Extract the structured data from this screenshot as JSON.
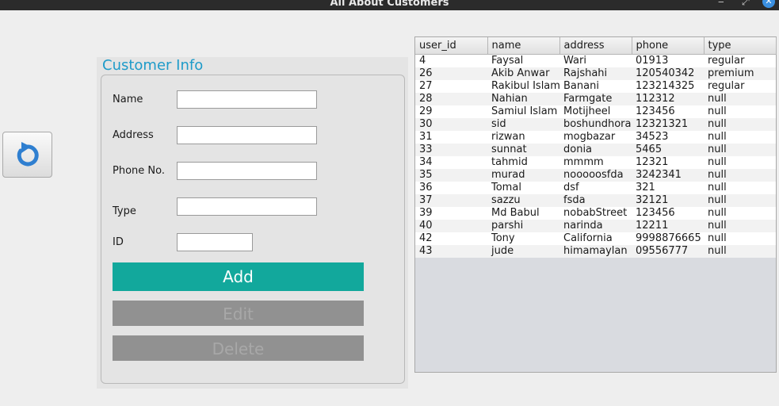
{
  "window": {
    "title": "All About Customers"
  },
  "panel": {
    "title": "Customer Info"
  },
  "form": {
    "name_label": "Name",
    "address_label": "Address",
    "phone_label": "Phone No.",
    "type_label": "Type",
    "id_label": "ID",
    "name_value": "",
    "address_value": "",
    "phone_value": "",
    "type_value": "",
    "id_value": ""
  },
  "buttons": {
    "add": "Add",
    "edit": "Edit",
    "delete": "Delete"
  },
  "table": {
    "columns": [
      "user_id",
      "name",
      "address",
      "phone",
      "type"
    ],
    "rows": [
      [
        "4",
        "Faysal",
        "Wari",
        "01913",
        "regular"
      ],
      [
        "26",
        "Akib Anwar",
        "Rajshahi",
        "120540342",
        "premium"
      ],
      [
        "27",
        "Rakibul Islam",
        "Banani",
        "123214325",
        "regular"
      ],
      [
        "28",
        "Nahian",
        "Farmgate",
        "112312",
        "null"
      ],
      [
        "29",
        "Samiul Islam",
        "Motijheel",
        "123456",
        "null"
      ],
      [
        "30",
        "sid",
        "boshundhora",
        "12321321",
        "null"
      ],
      [
        "31",
        "rizwan",
        "mogbazar",
        "34523",
        "null"
      ],
      [
        "33",
        "sunnat",
        "donia",
        "5465",
        "null"
      ],
      [
        "34",
        "tahmid",
        "mmmm",
        "12321",
        "null"
      ],
      [
        "35",
        "murad",
        "nooooosfda",
        "3242341",
        "null"
      ],
      [
        "36",
        "Tomal",
        "dsf",
        "321",
        "null"
      ],
      [
        "37",
        "sazzu",
        "fsda",
        "32121",
        "null"
      ],
      [
        "39",
        "Md Babul",
        "nobabStreet",
        "123456",
        "null"
      ],
      [
        "40",
        "parshi",
        "narinda",
        "12211",
        "null"
      ],
      [
        "42",
        "Tony",
        "California",
        "9998876665",
        "null"
      ],
      [
        "43",
        "jude",
        "himamaylan",
        "09556777",
        "null"
      ]
    ]
  },
  "icons": {
    "refresh": "refresh-icon",
    "minimize": "minimize-icon",
    "maximize": "maximize-icon",
    "close": "close-icon"
  },
  "colors": {
    "accent": "#12a89c",
    "title_blue": "#1e9bc9",
    "disabled": "#919191"
  }
}
